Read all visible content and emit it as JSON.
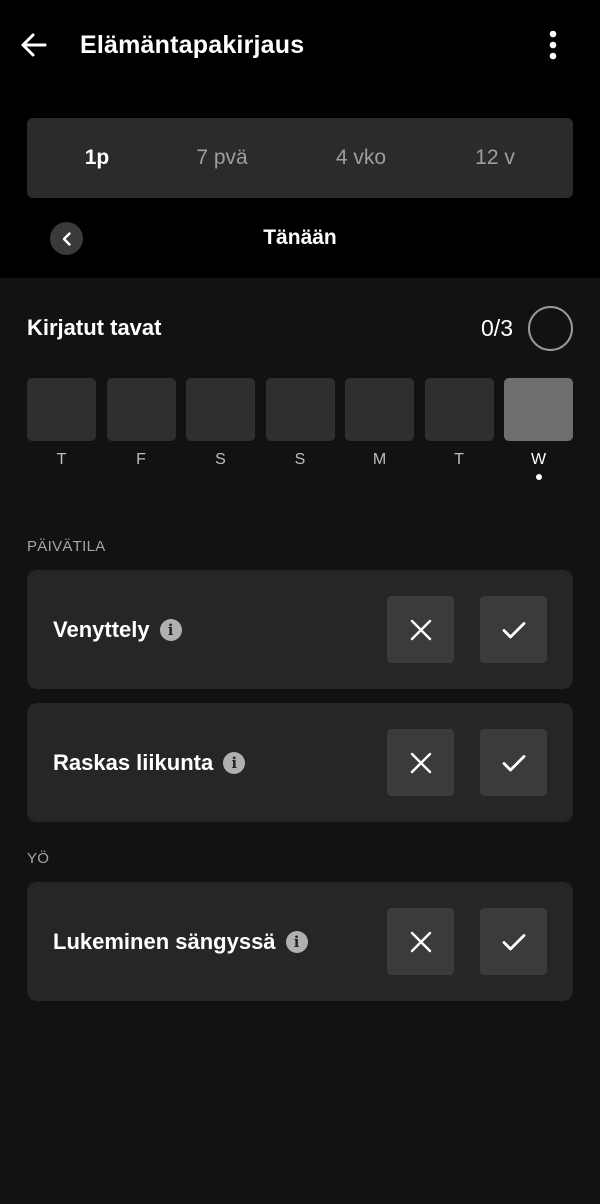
{
  "app": {
    "title": "Elämäntapakirjaus"
  },
  "range_tabs": [
    {
      "label": "1p",
      "active": true
    },
    {
      "label": "7 pvä",
      "active": false
    },
    {
      "label": "4 vko",
      "active": false
    },
    {
      "label": "12 v",
      "active": false
    }
  ],
  "date_nav": {
    "label": "Tänään"
  },
  "logged": {
    "title": "Kirjatut tavat",
    "count": "0/3"
  },
  "days": [
    {
      "letter": "T",
      "today": false
    },
    {
      "letter": "F",
      "today": false
    },
    {
      "letter": "S",
      "today": false
    },
    {
      "letter": "S",
      "today": false
    },
    {
      "letter": "M",
      "today": false
    },
    {
      "letter": "T",
      "today": false
    },
    {
      "letter": "W",
      "today": true
    }
  ],
  "groups": [
    {
      "label": "PÄIVÄTILA",
      "habits": [
        "Venyttely",
        "Raskas liikunta"
      ]
    },
    {
      "label": "YÖ",
      "habits": [
        "Lukeminen sängyssä"
      ]
    }
  ],
  "icons": {
    "back": "arrow-left-icon",
    "more": "more-vertical-icon",
    "prev": "chevron-left-icon",
    "info": "info-icon",
    "reject": "close-icon",
    "accept": "check-icon"
  },
  "colors": {
    "background": "#121212",
    "header": "#000000",
    "card": "#262626",
    "button": "#3b3b3b",
    "today_day": "#6e6e6e"
  }
}
